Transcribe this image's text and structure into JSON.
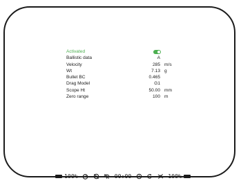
{
  "settings": {
    "rows": [
      {
        "label": "Activated",
        "value": "",
        "unit": ""
      },
      {
        "label": "Ballistic data",
        "value": "A",
        "unit": ""
      },
      {
        "label": "Velocity",
        "value": "285",
        "unit": "m/s"
      },
      {
        "label": "Wt",
        "value": "7.13",
        "unit": "g"
      },
      {
        "label": "Bullet BC",
        "value": "0.465",
        "unit": ""
      },
      {
        "label": "Drag Model",
        "value": "G1",
        "unit": ""
      },
      {
        "label": "Scope Ht",
        "value": "50.00",
        "unit": "mm"
      },
      {
        "label": "Zero range",
        "value": "100",
        "unit": "m"
      }
    ],
    "activated": true
  },
  "status_bar": {
    "left_battery": "100%",
    "time": "00:00",
    "right_battery": "100%",
    "icons": [
      "battery-icon",
      "timer-icon",
      "eye-off-icon",
      "wifi-icon",
      "clock-icon",
      "reload-icon",
      "satellite-off-icon",
      "battery-icon"
    ]
  },
  "colors": {
    "accent": "#4caf50",
    "text": "#1a1a1a",
    "frame": "#1a1a1a"
  }
}
